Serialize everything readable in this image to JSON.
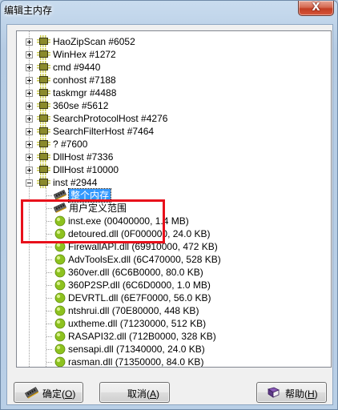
{
  "window": {
    "title": "编辑主内存",
    "close_glyph": "X"
  },
  "tree": {
    "processes": [
      {
        "label": "HaoZipScan #6052"
      },
      {
        "label": "WinHex #1272"
      },
      {
        "label": "cmd #9440"
      },
      {
        "label": "conhost #7188"
      },
      {
        "label": "taskmgr #4488"
      },
      {
        "label": "360se #5612"
      },
      {
        "label": "SearchProtocolHost #4276"
      },
      {
        "label": "SearchFilterHost #7464"
      },
      {
        "label": "? #7600"
      },
      {
        "label": "DllHost #7336"
      },
      {
        "label": "DllHost #10000"
      }
    ],
    "expanded_process": {
      "label": "inst #2944",
      "memory_items": [
        {
          "label": "整个内存",
          "selected": true
        },
        {
          "label": "用户定义范围",
          "selected": false
        }
      ],
      "modules": [
        {
          "label": "inst.exe (00400000, 1.4 MB)"
        },
        {
          "label": "detoured.dll (0F000000, 24.0 KB)"
        },
        {
          "label": "FirewallAPI.dll (69910000, 472 KB)"
        },
        {
          "label": "AdvToolsEx.dll (6C470000, 528 KB)"
        },
        {
          "label": "360ver.dll (6C6B0000, 80.0 KB)"
        },
        {
          "label": "360P2SP.dll (6C6D0000, 1.0 MB)"
        },
        {
          "label": "DEVRTL.dll (6E7F0000, 56.0 KB)"
        },
        {
          "label": "ntshrui.dll (70E80000, 448 KB)"
        },
        {
          "label": "uxtheme.dll (71230000, 512 KB)"
        },
        {
          "label": "RASAPI32.dll (712B0000, 328 KB)"
        },
        {
          "label": "sensapi.dll (71340000, 24.0 KB)"
        },
        {
          "label": "rasman.dll (71350000, 84.0 KB)"
        }
      ]
    }
  },
  "buttons": {
    "ok": {
      "label": "确定(",
      "hotkey": "O",
      "suffix": ")"
    },
    "cancel": {
      "label": "取消(",
      "hotkey": "A",
      "suffix": ")"
    },
    "help": {
      "label": "帮助(",
      "hotkey": "H",
      "suffix": ")"
    }
  },
  "icons": {
    "process": "process-chip-icon",
    "module": "dll-module-icon",
    "memory": "ram-module-icon",
    "ok": "ram-module-icon",
    "help": "book-icon"
  },
  "colors": {
    "selection": "#3399ff",
    "highlight_box": "#e8101b",
    "module_green": "#8dc21f"
  }
}
